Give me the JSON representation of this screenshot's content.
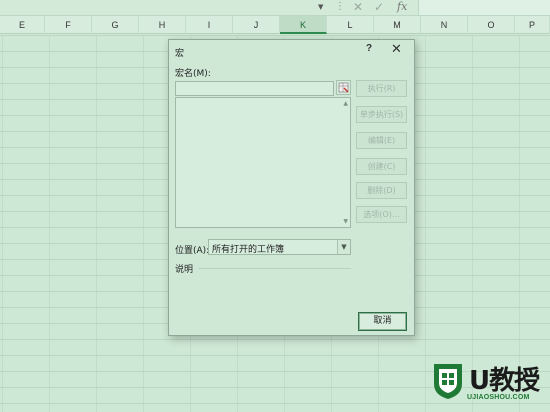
{
  "formula_bar": {
    "cancel_icon": "x-icon",
    "enter_icon": "check-icon",
    "fx_label": "fx"
  },
  "columns": [
    "E",
    "F",
    "G",
    "H",
    "I",
    "J",
    "K",
    "L",
    "M",
    "N",
    "O",
    "P"
  ],
  "selected_column": "K",
  "dialog": {
    "title": "宏",
    "help": "?",
    "close": "✕",
    "macro_name_label": "宏名(M):",
    "macro_name_value": "",
    "buttons": {
      "run": "执行(R)",
      "step_into": "单步执行(S)",
      "edit": "编辑(E)",
      "create": "创建(C)",
      "delete": "删除(D)",
      "options": "选项(O)..."
    },
    "location_label": "位置(A):",
    "location_value": "所有打开的工作簿",
    "description_label": "说明",
    "cancel": "取消"
  },
  "watermark": {
    "brand": "U教授",
    "url": "UJIAOSHOU.COM"
  },
  "colors": {
    "sheet_bg": "#cde8d4",
    "dialog_bg": "#cfe8d6",
    "accent_green": "#1f7a35"
  }
}
